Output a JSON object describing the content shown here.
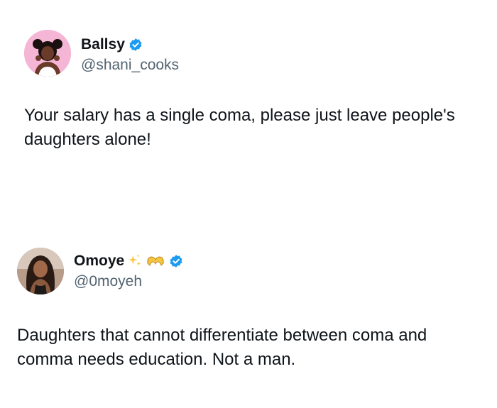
{
  "tweets": [
    {
      "display_name": "Ballsy",
      "handle": "@shani_cooks",
      "verified": true,
      "text": "Your salary has a single coma, please just leave people's daughters alone!"
    },
    {
      "display_name": "Omoye",
      "handle": "@0moyeh",
      "verified": true,
      "name_emojis": [
        "sparkles-icon",
        "heart-hands-icon"
      ],
      "text": "Daughters that cannot differentiate between coma and comma needs education. Not a man."
    }
  ],
  "colors": {
    "text_primary": "#0f1419",
    "text_secondary": "#536471",
    "verified_blue": "#1d9bf0",
    "avatar_1_bg": "#f4b6d4",
    "sparkle_gold": "#f5c542"
  }
}
